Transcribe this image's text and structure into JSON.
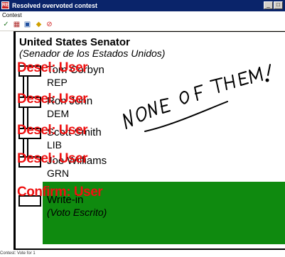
{
  "window": {
    "title": "Resolved overvoted contest",
    "icon_label": "RE",
    "controls": [
      "_",
      "□"
    ]
  },
  "menu": {
    "items": [
      "Contest"
    ]
  },
  "toolbar": {
    "buttons": [
      {
        "name": "accept-check-icon",
        "glyph": "✓",
        "color": "#2a7a2a"
      },
      {
        "name": "ballot-image-icon",
        "glyph": "▦",
        "color": "#b03030"
      },
      {
        "name": "view-icon",
        "glyph": "▣",
        "color": "#2050a0"
      },
      {
        "name": "flag-icon",
        "glyph": "◆",
        "color": "#d0a000"
      },
      {
        "name": "reject-icon",
        "glyph": "⊘",
        "color": "#d02020"
      }
    ]
  },
  "ballot": {
    "contest_title": "United States Senator",
    "contest_subtitle": "(Senador de los Estados Unidos)",
    "candidates": [
      {
        "name": "Tom Corbyn",
        "party": "REP",
        "overlay": "Desel: User"
      },
      {
        "name": "Ron John",
        "party": "DEM",
        "overlay": "Desel: User"
      },
      {
        "name": "Scott Smith",
        "party": "LIB",
        "overlay": "Desel: User"
      },
      {
        "name": "Joe Williams",
        "party": "GRN",
        "overlay": "Desel: User"
      }
    ],
    "writein": {
      "name": "Write-in",
      "subtitle": "(Voto Escrito)",
      "overlay": "Confirm: User"
    },
    "handwritten_note": "NONE OF THEM!",
    "writein_fill_color": "#0f8a0f",
    "overlay_color": "#ee1111"
  },
  "status": {
    "text": "Contest: Vote for 1"
  }
}
